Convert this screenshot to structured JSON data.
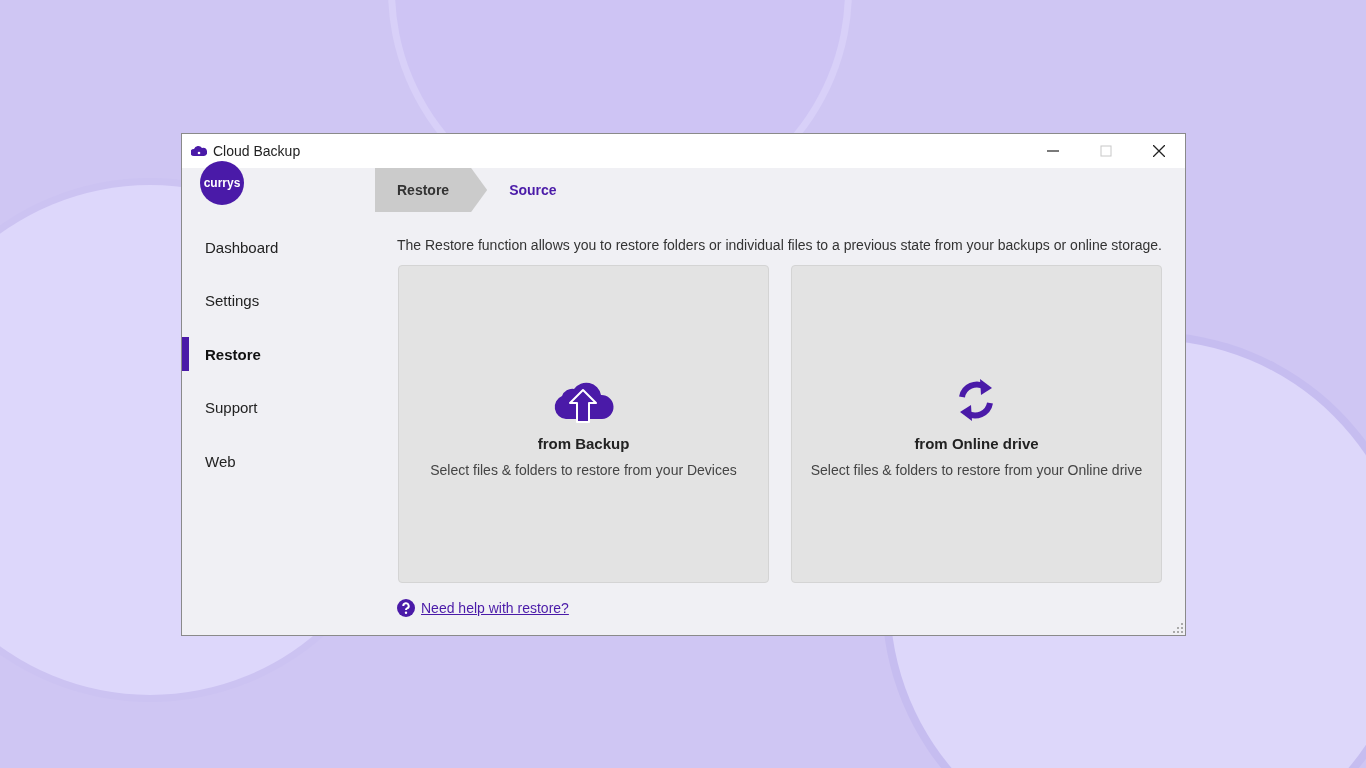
{
  "window": {
    "title": "Cloud Backup",
    "controls": [
      {
        "kind": "minimize",
        "disabled": false
      },
      {
        "kind": "maximize",
        "disabled": true
      },
      {
        "kind": "close",
        "disabled": false
      }
    ]
  },
  "logo": {
    "text": "currys"
  },
  "sidebar": {
    "items": [
      {
        "label": "Dashboard",
        "selected": false
      },
      {
        "label": "Settings",
        "selected": false
      },
      {
        "label": "Restore",
        "selected": true
      },
      {
        "label": "Support",
        "selected": false
      },
      {
        "label": "Web",
        "selected": false
      }
    ]
  },
  "breadcrumb": [
    {
      "label": "Restore",
      "selected": false
    },
    {
      "label": "Source",
      "selected": true
    }
  ],
  "description": "The Restore function allows you to restore folders or individual files to a previous state from your backups or online storage.",
  "options": [
    {
      "kind": "backup",
      "title": "from Backup",
      "subtitle": "Select files & folders to restore from your Devices"
    },
    {
      "kind": "online",
      "title": "from Online drive",
      "subtitle": "Select files & folders to restore from your Online drive"
    }
  ],
  "help_link": "Need help with restore?"
}
